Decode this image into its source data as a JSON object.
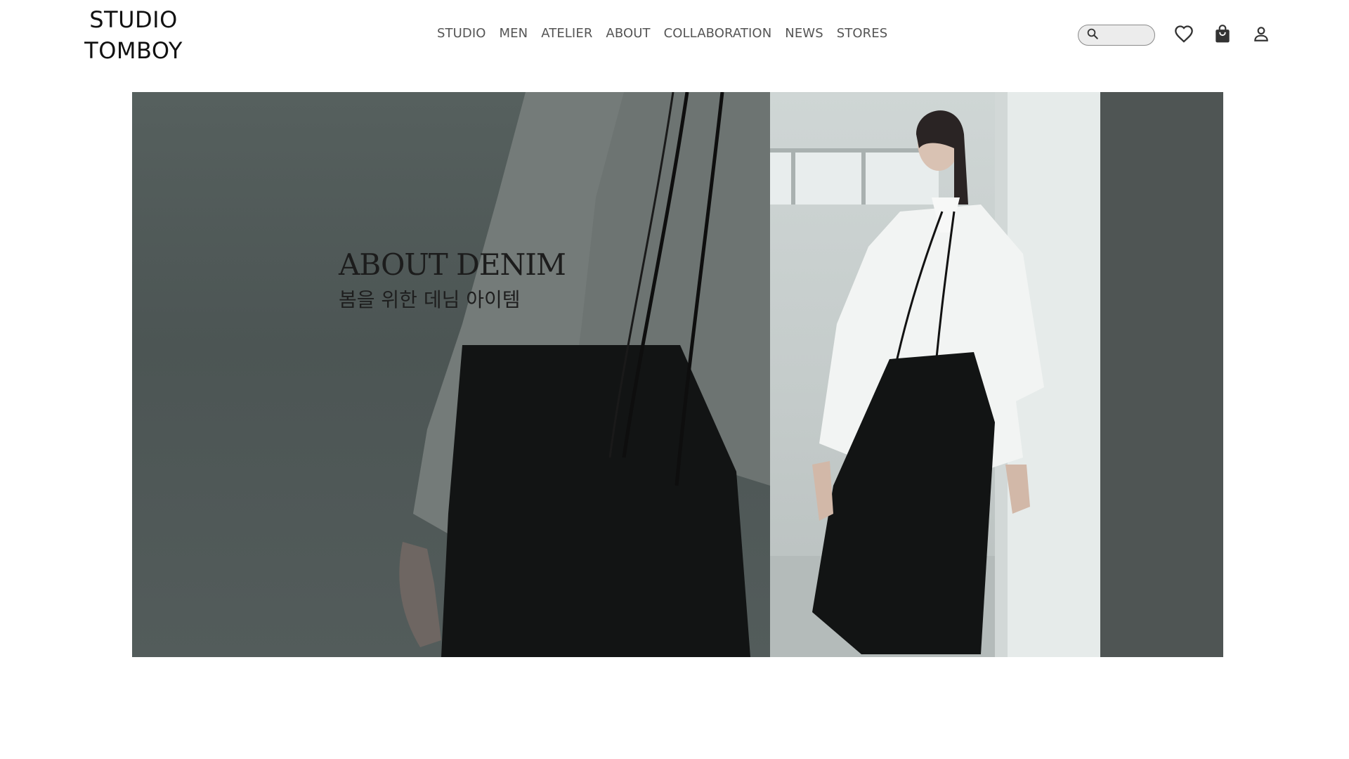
{
  "brand": {
    "line1": "STUDIO",
    "line2": "TOMBOY"
  },
  "nav": {
    "items": [
      "STUDIO",
      "MEN",
      "ATELIER",
      "ABOUT",
      "COLLABORATION",
      "NEWS",
      "STORES"
    ]
  },
  "search": {
    "value": "",
    "placeholder": ""
  },
  "icons": {
    "search": "search-icon",
    "wishlist": "heart-icon",
    "cart": "shopping-bag-icon",
    "account": "user-icon"
  },
  "hero": {
    "title": "ABOUT DENIM",
    "subtitle": "봄을 위한 데님 아이템"
  },
  "colors": {
    "nav_text": "#555555",
    "hero_dark": "#4e5453",
    "hero_light": "#cfd6d5"
  }
}
